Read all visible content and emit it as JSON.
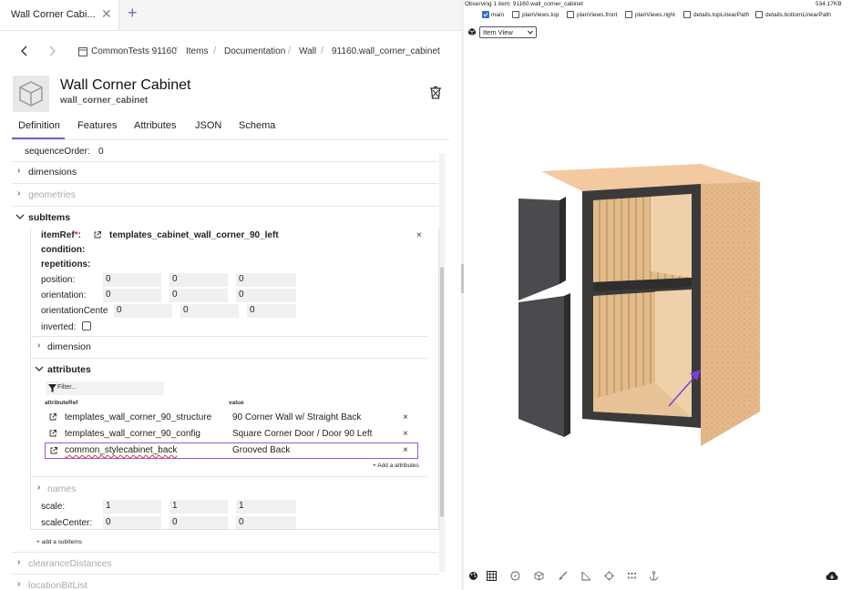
{
  "tab": {
    "title": "Wall Corner Cabi...",
    "close": "✕",
    "new": "+"
  },
  "breadcrumb": {
    "root": "CommonTests 91160",
    "items": [
      "Items",
      "Documentation",
      "Wall",
      "91160.wall_corner_cabinet"
    ],
    "separator": "/"
  },
  "header": {
    "title": "Wall Corner Cabinet",
    "subtitle": "wall_corner_cabinet"
  },
  "tabs": [
    "Definition",
    "Features",
    "Attributes",
    "JSON",
    "Schema"
  ],
  "tabs_active": "Definition",
  "accent": "#7b61c9",
  "tree": {
    "sequenceOrder": {
      "label": "sequenceOrder:",
      "value": "0"
    },
    "dimensions": "dimensions",
    "geometries": "geometries",
    "subItems": "subItems",
    "sub": {
      "itemRef_label": "itemRef",
      "itemRef_required": "*",
      "itemRef_colon": ":",
      "itemRef_value": "templates_cabinet_wall_corner_90_left",
      "remove": "×",
      "condition": "condition:",
      "repetitions": "repetitions:",
      "position": {
        "label": "position:",
        "values": [
          "0",
          "0",
          "0"
        ]
      },
      "orientation": {
        "label": "orientation:",
        "values": [
          "0",
          "0",
          "0"
        ]
      },
      "orientationCenter": {
        "label": "orientationCente",
        "values": [
          "0",
          "0",
          "0"
        ]
      },
      "inverted": "inverted:",
      "dimension": "dimension",
      "attributes": "attributes",
      "filter_placeholder": "Filter...",
      "table_headers": [
        "attributeRef",
        "value"
      ],
      "rows": [
        {
          "ref": "templates_wall_corner_90_structure",
          "value": "90 Corner Wall w/ Straight Back"
        },
        {
          "ref": "templates_wall_corner_90_config",
          "value": "Square Corner Door / Door 90 Left"
        },
        {
          "ref": "common_stylecabinet_back",
          "value": "Grooved Back"
        }
      ],
      "add_attribute": "+ Add a attributes",
      "names": "names",
      "scale": {
        "label": "scale:",
        "values": [
          "1",
          "1",
          "1"
        ]
      },
      "scaleCenter": {
        "label": "scaleCenter:",
        "values": [
          "0",
          "0",
          "0"
        ]
      }
    },
    "add_subitem": "+ add a subItems",
    "clearanceDistances": "clearanceDistances",
    "truncated": "locationBitList"
  },
  "viewer": {
    "observing": "Observing 1 item: 91160.wall_corner_cabinet",
    "size": "534.17KB",
    "checks": [
      {
        "label": "main",
        "checked": true
      },
      {
        "label": "planViews.top",
        "checked": false
      },
      {
        "label": "planViews.front",
        "checked": false
      },
      {
        "label": "planViews.right",
        "checked": false
      },
      {
        "label": "details.topLinearPath",
        "checked": false
      },
      {
        "label": "details.bottomLinearPath",
        "checked": false
      }
    ],
    "view_select": "Item View",
    "toolbar_icons": [
      "palette-icon",
      "grid-icon",
      "compass-icon",
      "cube-icon",
      "brush-icon",
      "ruler-icon",
      "target-icon",
      "dots-grid-icon",
      "anchor-icon"
    ],
    "cloud_icon": "cloud-download-icon"
  }
}
